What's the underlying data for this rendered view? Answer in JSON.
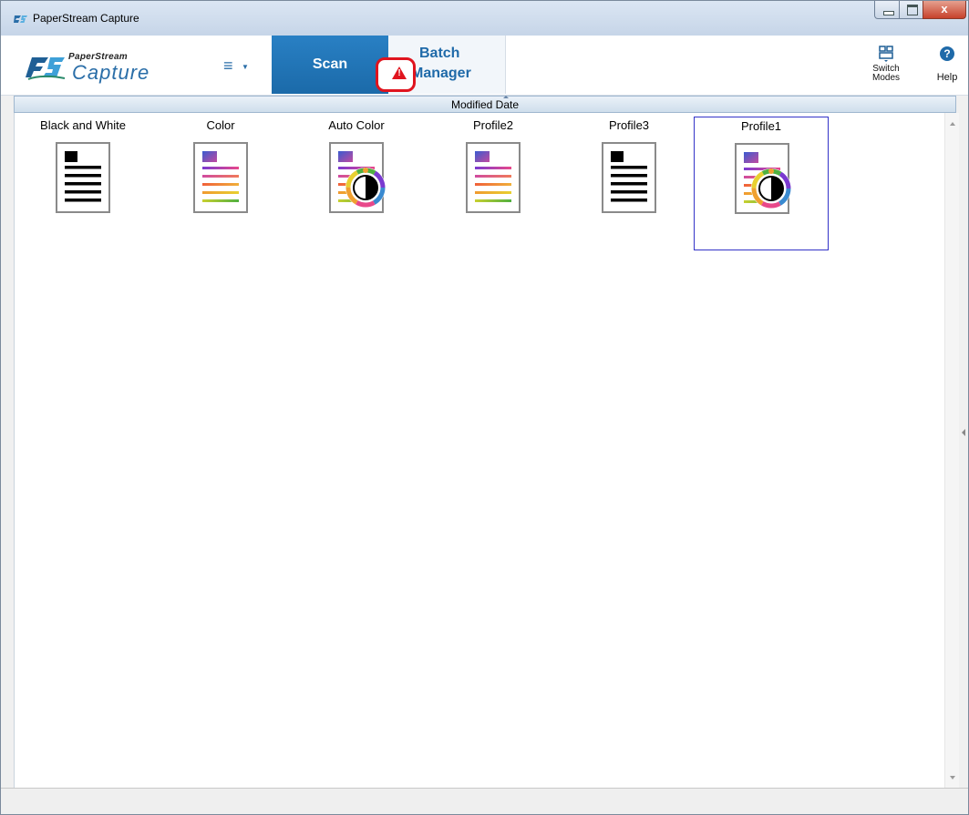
{
  "window": {
    "title": "PaperStream Capture",
    "close_glyph": "x"
  },
  "toolbar": {
    "logo_small": "PaperStream",
    "logo_big": "Capture",
    "menu_glyph": "≡",
    "tabs": [
      {
        "label": "Scan",
        "active": true
      },
      {
        "label_line1": "Batch",
        "label_line2": "Manager",
        "active": false,
        "warning_icon": "warning-triangle-icon"
      }
    ],
    "switch_modes_label_1": "Switch",
    "switch_modes_label_2": "Modes",
    "help_glyph": "?",
    "help_label": "Help"
  },
  "sort_header": {
    "label": "Modified Date"
  },
  "profiles": [
    {
      "name": "Black and White",
      "icon": "bw-document-icon",
      "selected": false
    },
    {
      "name": "Color",
      "icon": "color-document-icon",
      "selected": false
    },
    {
      "name": "Auto Color",
      "icon": "auto-color-document-icon",
      "selected": false
    },
    {
      "name": "Profile2",
      "icon": "color-document-icon",
      "selected": false
    },
    {
      "name": "Profile3",
      "icon": "bw-document-icon",
      "selected": false
    },
    {
      "name": "Profile1",
      "icon": "auto-color-document-icon",
      "selected": true
    }
  ],
  "colors": {
    "accent": "#1f6aa9",
    "scan_tab": "#2980c4",
    "warning": "#e0141e",
    "selection_border": "#3333c8"
  }
}
